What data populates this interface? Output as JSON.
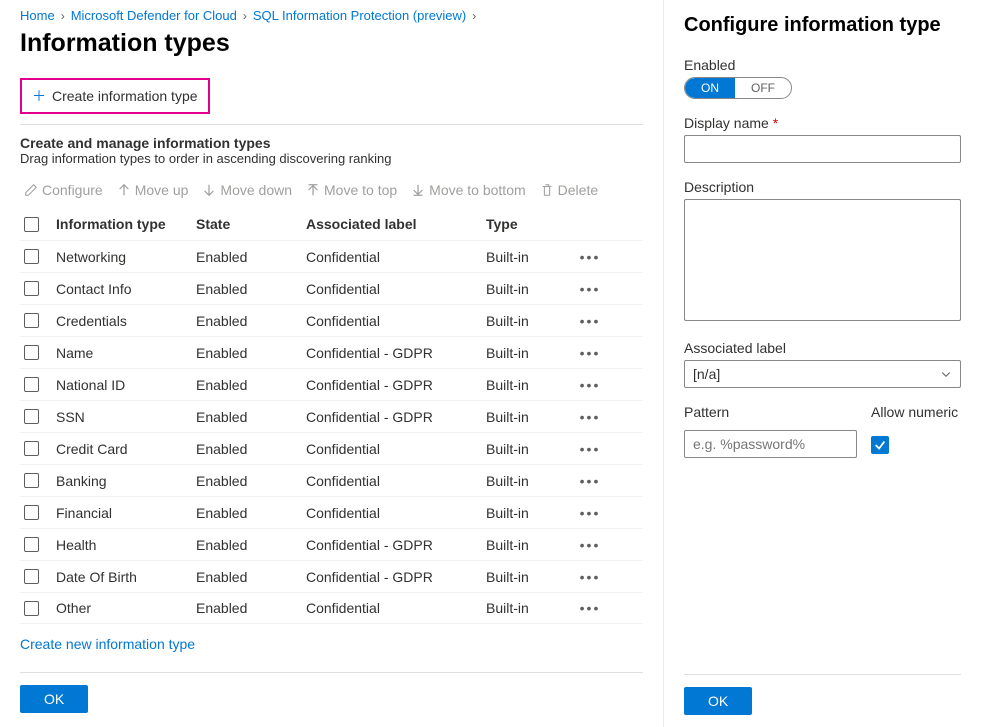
{
  "breadcrumb": [
    {
      "label": "Home"
    },
    {
      "label": "Microsoft Defender for Cloud"
    },
    {
      "label": "SQL Information Protection (preview)"
    }
  ],
  "page": {
    "title": "Information types",
    "create_button": "Create information type",
    "section_title": "Create and manage information types",
    "section_subtitle": "Drag information types to order in ascending discovering ranking",
    "create_link": "Create new information type",
    "ok_label": "OK"
  },
  "toolbar": {
    "configure": "Configure",
    "move_up": "Move up",
    "move_down": "Move down",
    "move_top": "Move to top",
    "move_bottom": "Move to bottom",
    "delete": "Delete"
  },
  "columns": {
    "name": "Information type",
    "state": "State",
    "label": "Associated label",
    "type": "Type"
  },
  "rows": [
    {
      "name": "Networking",
      "state": "Enabled",
      "label": "Confidential",
      "type": "Built-in"
    },
    {
      "name": "Contact Info",
      "state": "Enabled",
      "label": "Confidential",
      "type": "Built-in"
    },
    {
      "name": "Credentials",
      "state": "Enabled",
      "label": "Confidential",
      "type": "Built-in"
    },
    {
      "name": "Name",
      "state": "Enabled",
      "label": "Confidential - GDPR",
      "type": "Built-in"
    },
    {
      "name": "National ID",
      "state": "Enabled",
      "label": "Confidential - GDPR",
      "type": "Built-in"
    },
    {
      "name": "SSN",
      "state": "Enabled",
      "label": "Confidential - GDPR",
      "type": "Built-in"
    },
    {
      "name": "Credit Card",
      "state": "Enabled",
      "label": "Confidential",
      "type": "Built-in"
    },
    {
      "name": "Banking",
      "state": "Enabled",
      "label": "Confidential",
      "type": "Built-in"
    },
    {
      "name": "Financial",
      "state": "Enabled",
      "label": "Confidential",
      "type": "Built-in"
    },
    {
      "name": "Health",
      "state": "Enabled",
      "label": "Confidential - GDPR",
      "type": "Built-in"
    },
    {
      "name": "Date Of Birth",
      "state": "Enabled",
      "label": "Confidential - GDPR",
      "type": "Built-in"
    },
    {
      "name": "Other",
      "state": "Enabled",
      "label": "Confidential",
      "type": "Built-in"
    }
  ],
  "blade": {
    "title": "Configure information type",
    "enabled_label": "Enabled",
    "toggle_on": "ON",
    "toggle_off": "OFF",
    "display_name_label": "Display name",
    "description_label": "Description",
    "associated_label_label": "Associated label",
    "associated_label_value": "[n/a]",
    "pattern_label": "Pattern",
    "pattern_placeholder": "e.g. %password%",
    "allow_numeric_label": "Allow numeric",
    "ok_label": "OK"
  }
}
